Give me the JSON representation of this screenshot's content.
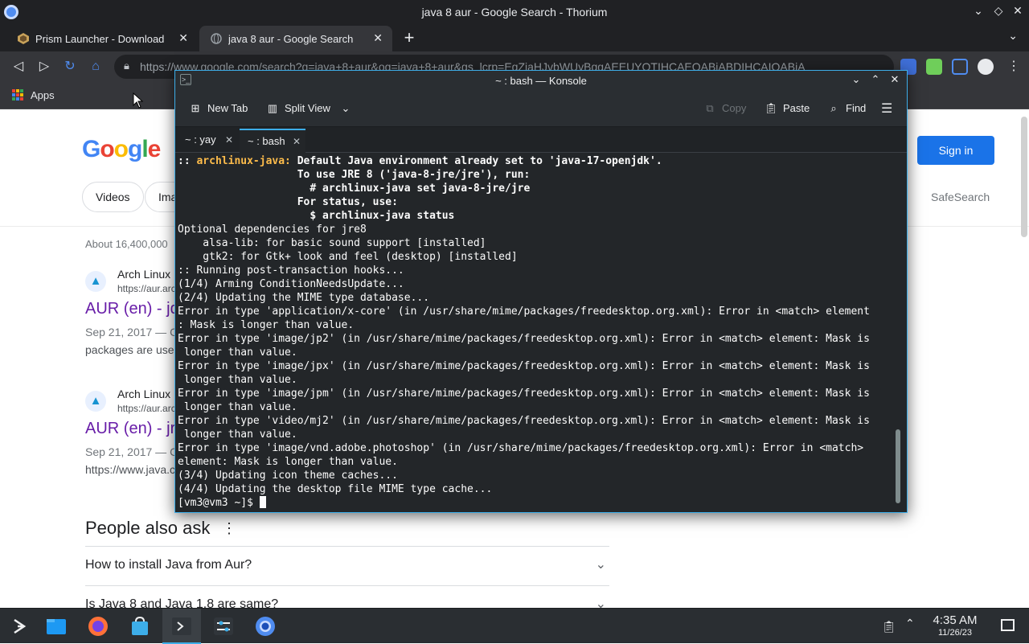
{
  "browser": {
    "window_title": "java 8 aur - Google Search - Thorium",
    "tabs": [
      {
        "label": "Prism Launcher - Download",
        "active": false
      },
      {
        "label": "java 8 aur - Google Search",
        "active": true
      }
    ],
    "url": "https://www.google.com/search?q=java+8+aur&oq=java+8+aur&gs_lcrp=EgZjaHJvbWUyBggAEEUYOTIHCAEQABiABDIHCAIQABiA",
    "bookmarks": {
      "apps_label": "Apps"
    }
  },
  "google": {
    "logo": "Google",
    "sign_in": "Sign in",
    "chips": [
      "Videos",
      "Ima"
    ],
    "safesearch": "SafeSearch",
    "about": "About 16,400,000",
    "results": [
      {
        "site": "Arch Linux",
        "cite": "https://aur.arc",
        "title": "AUR (en) - jd",
        "date": "Sep 21, 2017 — C",
        "snippet": "packages are use"
      },
      {
        "site": "Arch Linux",
        "cite": "https://aur.arc",
        "title": "AUR (en) - jr",
        "date": "Sep 21, 2017 — C",
        "snippet": "https://www.java.c"
      }
    ],
    "people_also_ask": {
      "title": "People also ask",
      "questions": [
        "How to install Java from Aur?",
        "Is Java 8 and Java 1.8 are same?"
      ]
    }
  },
  "konsole": {
    "title": "~ : bash — Konsole",
    "toolbar": {
      "new_tab": "New Tab",
      "split_view": "Split View",
      "copy": "Copy",
      "paste": "Paste",
      "find": "Find"
    },
    "tabs": [
      {
        "label": "~ : yay",
        "active": false
      },
      {
        "label": "~ : bash",
        "active": true
      }
    ],
    "terminal": {
      "l01_prefix": ":: ",
      "l01_tag": "archlinux-java:",
      "l01_text": " Default Java environment already set to 'java-17-openjdk'.",
      "l02": "                   To use JRE 8 ('java-8-jre/jre'), run:",
      "l03": "                     # archlinux-java set java-8-jre/jre",
      "l04": "                   For status, use:",
      "l05": "                     $ archlinux-java status",
      "l06": "Optional dependencies for jre8",
      "l07": "    alsa-lib: for basic sound support [installed]",
      "l08": "    gtk2: for Gtk+ look and feel (desktop) [installed]",
      "l09": ":: Running post-transaction hooks...",
      "l10": "(1/4) Arming ConditionNeedsUpdate...",
      "l11": "(2/4) Updating the MIME type database...",
      "l12": "Error in type 'application/x-core' (in /usr/share/mime/packages/freedesktop.org.xml): Error in <match> element",
      "l13": ": Mask is longer than value.",
      "l14": "Error in type 'image/jp2' (in /usr/share/mime/packages/freedesktop.org.xml): Error in <match> element: Mask is",
      "l15": " longer than value.",
      "l16": "Error in type 'image/jpx' (in /usr/share/mime/packages/freedesktop.org.xml): Error in <match> element: Mask is",
      "l17": " longer than value.",
      "l18": "Error in type 'image/jpm' (in /usr/share/mime/packages/freedesktop.org.xml): Error in <match> element: Mask is",
      "l19": " longer than value.",
      "l20": "Error in type 'video/mj2' (in /usr/share/mime/packages/freedesktop.org.xml): Error in <match> element: Mask is",
      "l21": " longer than value.",
      "l22": "Error in type 'image/vnd.adobe.photoshop' (in /usr/share/mime/packages/freedesktop.org.xml): Error in <match>",
      "l23": "element: Mask is longer than value.",
      "l24": "(3/4) Updating icon theme caches...",
      "l25": "(4/4) Updating the desktop file MIME type cache...",
      "prompt": "[vm3@vm3 ~]$ "
    }
  },
  "taskbar": {
    "apps": [
      {
        "icon": "application-launcher-icon"
      },
      {
        "icon": "file-manager-icon"
      },
      {
        "icon": "firefox-icon"
      },
      {
        "icon": "software-store-icon"
      },
      {
        "icon": "konsole-icon",
        "active": true
      },
      {
        "icon": "system-settings-icon"
      },
      {
        "icon": "thorium-icon"
      }
    ],
    "clock_time": "4:35 AM",
    "clock_date": "11/26/23"
  },
  "colors": {
    "accent": "#3daee9",
    "google_blue": "#1a73e8",
    "visited_link": "#681da8",
    "terminal_yellow": "#fdbc4b"
  }
}
